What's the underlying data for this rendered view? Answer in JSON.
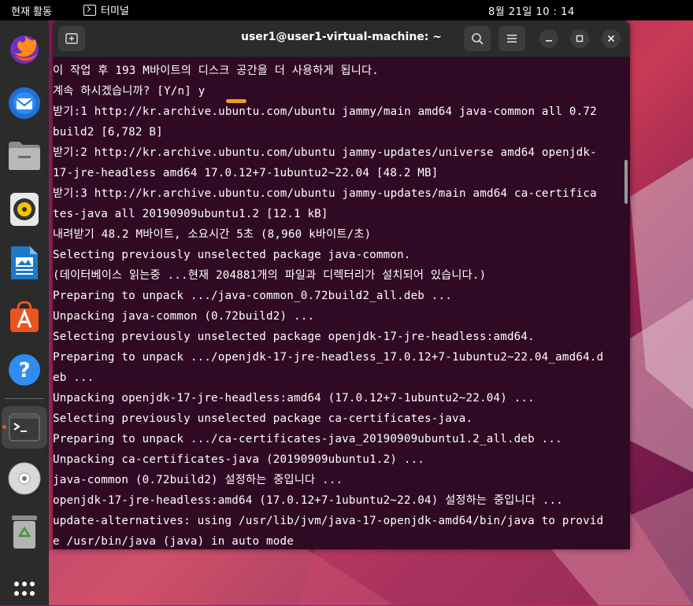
{
  "topbar": {
    "activities": "현재 활동",
    "app_name": "터미널",
    "clock": "8월 21일  10 : 14"
  },
  "dock": {
    "items": [
      {
        "name": "firefox-icon"
      },
      {
        "name": "thunderbird-icon"
      },
      {
        "name": "files-icon"
      },
      {
        "name": "rhythmbox-icon"
      },
      {
        "name": "writer-icon"
      },
      {
        "name": "app-center-icon"
      },
      {
        "name": "help-icon"
      },
      {
        "name": "terminal-icon",
        "active": true
      },
      {
        "name": "disc-icon"
      },
      {
        "name": "trash-icon"
      },
      {
        "name": "show-apps-icon"
      }
    ]
  },
  "window": {
    "title": "user1@user1-virtual-machine: ~"
  },
  "terminal_lines": [
    "이 작업 후 193 M바이트의 디스크 공간을 더 사용하게 됩니다.",
    "계속 하시겠습니까? [Y/n] y",
    "받기:1 http://kr.archive.ubuntu.com/ubuntu jammy/main amd64 java-common all 0.72",
    "build2 [6,782 B]",
    "받기:2 http://kr.archive.ubuntu.com/ubuntu jammy-updates/universe amd64 openjdk-",
    "17-jre-headless amd64 17.0.12+7-1ubuntu2~22.04 [48.2 MB]",
    "받기:3 http://kr.archive.ubuntu.com/ubuntu jammy-updates/main amd64 ca-certifica",
    "tes-java all 20190909ubuntu1.2 [12.1 kB]",
    "내려받기 48.2 M바이트, 소요시간 5초 (8,960 k바이트/초)",
    "Selecting previously unselected package java-common.",
    "(데이터베이스 읽는중 ...현재 204881개의 파일과 디렉터리가 설치되어 있습니다.)",
    "Preparing to unpack .../java-common_0.72build2_all.deb ...",
    "Unpacking java-common (0.72build2) ...",
    "Selecting previously unselected package openjdk-17-jre-headless:amd64.",
    "Preparing to unpack .../openjdk-17-jre-headless_17.0.12+7-1ubuntu2~22.04_amd64.d",
    "eb ...",
    "Unpacking openjdk-17-jre-headless:amd64 (17.0.12+7-1ubuntu2~22.04) ...",
    "Selecting previously unselected package ca-certificates-java.",
    "Preparing to unpack .../ca-certificates-java_20190909ubuntu1.2_all.deb ...",
    "Unpacking ca-certificates-java (20190909ubuntu1.2) ...",
    "java-common (0.72build2) 설정하는 중입니다 ...",
    "openjdk-17-jre-headless:amd64 (17.0.12+7-1ubuntu2~22.04) 설정하는 중입니다 ...",
    "update-alternatives: using /usr/lib/jvm/java-17-openjdk-amd64/bin/java to provid",
    "e /usr/bin/java (java) in auto mode"
  ],
  "colors": {
    "terminal_bg": "#300a24",
    "accent": "#e95420",
    "highlight": "#f29a1f"
  }
}
